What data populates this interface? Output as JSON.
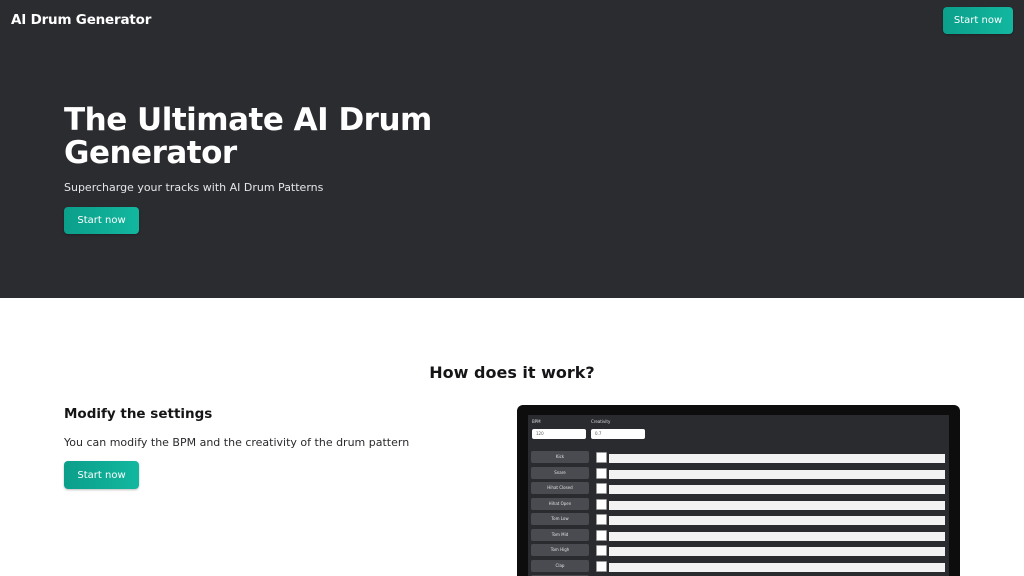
{
  "header": {
    "brand": "AI Drum Generator",
    "cta_label": "Start now"
  },
  "hero": {
    "title": "The Ultimate AI Drum Generator",
    "subtitle": "Supercharge your tracks with AI Drum Patterns",
    "cta_label": "Start now"
  },
  "how": {
    "title": "How does it work?",
    "step": {
      "title": "Modify the settings",
      "description": "You can modify the BPM and the creativity of the drum pattern",
      "cta_label": "Start now"
    }
  },
  "preview": {
    "bpm_label": "BPM",
    "bpm_value": "120",
    "creativity_label": "Creativity",
    "creativity_value": "0.7",
    "instruments": [
      "Kick",
      "Snare",
      "Hihat Closed",
      "Hihat Open",
      "Tom Low",
      "Tom Mid",
      "Tom High",
      "Clap"
    ]
  },
  "colors": {
    "hero_bg": "#2b2c30",
    "accent": "#12b79f",
    "page_bg": "#ffffff"
  }
}
